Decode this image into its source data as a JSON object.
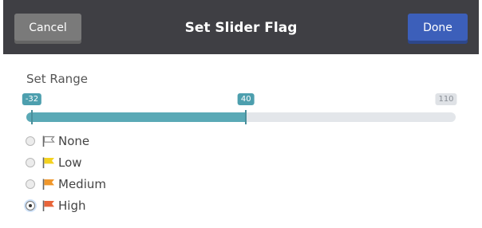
{
  "header": {
    "title": "Set Slider Flag",
    "cancel_label": "Cancel",
    "done_label": "Done",
    "background_color": "#3f3f44",
    "done_color": "#3c5fba",
    "cancel_color": "#7a7a7a"
  },
  "range": {
    "label": "Set Range",
    "min": -32,
    "max": 110,
    "value": 40,
    "min_label": "-32",
    "value_label": "40",
    "max_label": "110",
    "fill_color": "#5aa9b6"
  },
  "flags": [
    {
      "label": "None",
      "icon": "flag-outline-icon",
      "color": "#8a8a8a",
      "selected": false
    },
    {
      "label": "Low",
      "icon": "flag-icon",
      "color": "#f4d21f",
      "selected": false
    },
    {
      "label": "Medium",
      "icon": "flag-icon",
      "color": "#f0972b",
      "selected": false
    },
    {
      "label": "High",
      "icon": "flag-icon",
      "color": "#e8653a",
      "selected": true
    }
  ]
}
